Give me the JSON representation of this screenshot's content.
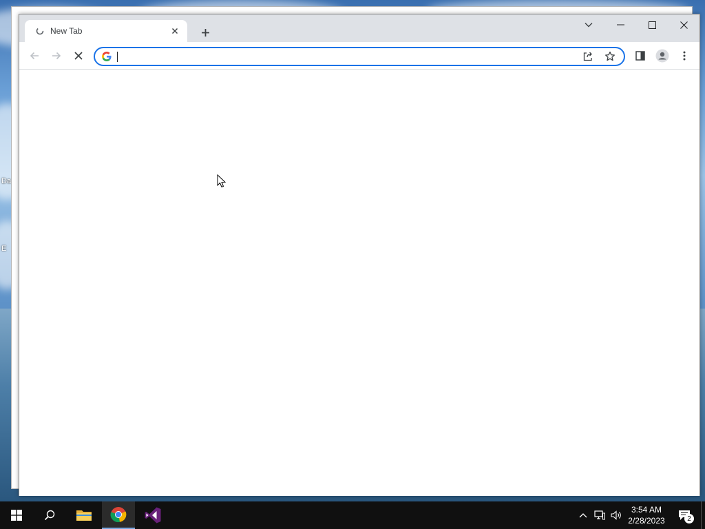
{
  "desktop": {
    "labels": [
      "Da",
      "E"
    ]
  },
  "browser": {
    "tab": {
      "title": "New Tab",
      "favicon": "loading-icon"
    },
    "new_tab_icon": "plus-icon",
    "window_controls": {
      "tab_search_icon": "chevron-down-icon",
      "minimize_icon": "minimize-icon",
      "maximize_icon": "maximize-icon",
      "close_icon": "close-icon"
    },
    "toolbar": {
      "back_icon": "arrow-left-icon",
      "forward_icon": "arrow-right-icon",
      "stop_icon": "stop-icon",
      "share_icon": "share-icon",
      "bookmark_icon": "star-icon",
      "side_panel_icon": "side-panel-icon",
      "profile_icon": "profile-icon",
      "menu_icon": "kebab-menu-icon"
    },
    "omnibox": {
      "value": "",
      "placeholder": "",
      "search_engine_icon": "google-g-icon"
    },
    "accent_color": "#1a73e8"
  },
  "taskbar": {
    "apps": [
      {
        "name": "Start",
        "icon": "windows-start-icon"
      },
      {
        "name": "Search",
        "icon": "search-icon"
      },
      {
        "name": "File Explorer",
        "icon": "folder-icon"
      },
      {
        "name": "Google Chrome",
        "icon": "chrome-icon",
        "active": true
      },
      {
        "name": "Visual Studio",
        "icon": "visual-studio-icon"
      }
    ],
    "tray": {
      "time": "3:54 AM",
      "date": "2/28/2023",
      "notification_count": "2"
    }
  }
}
